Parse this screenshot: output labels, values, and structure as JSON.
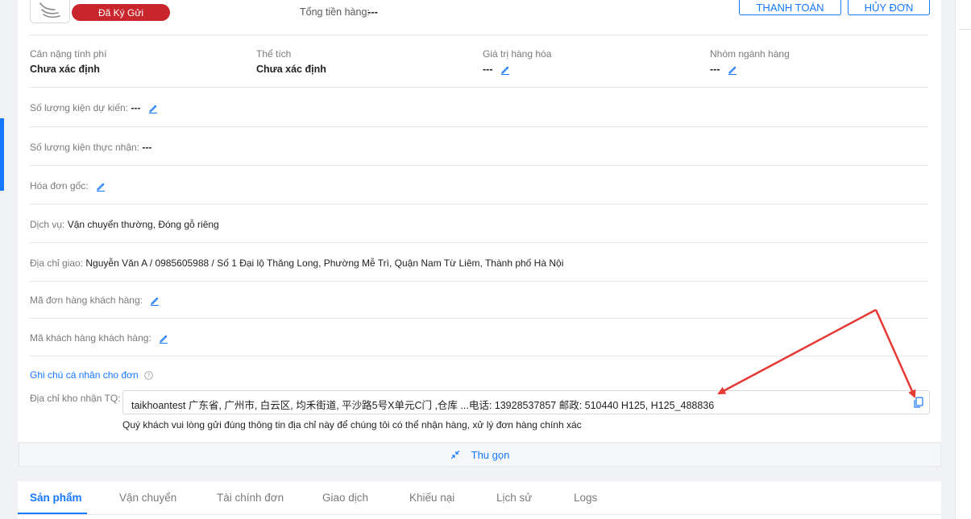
{
  "header": {
    "status_badge": "Đã Ký Gửi",
    "total_label": "Tổng tiền hàng:",
    "total_value": "---",
    "pay_button": "THANH TOÁN",
    "cancel_button": "HỦY ĐƠN"
  },
  "info": {
    "weight": {
      "label": "Cân nặng tính phí",
      "value": "Chưa xác định"
    },
    "volume": {
      "label": "Thể tích",
      "value": "Chưa xác định"
    },
    "goods_value": {
      "label": "Giá trị hàng hóa",
      "value": "---"
    },
    "category": {
      "label": "Nhóm ngành hàng",
      "value": "---"
    }
  },
  "rows": {
    "expected_packages": {
      "label": "Số lượng kiện dự kiến:",
      "value": "---"
    },
    "received_packages": {
      "label": "Số lượng kiện thực nhận:",
      "value": "---"
    },
    "original_invoice": {
      "label": "Hóa đơn gốc:"
    },
    "service": {
      "label": "Dịch vụ:",
      "value": "Vận chuyển thường,  Đóng gỗ riêng"
    },
    "delivery_address": {
      "label": "Địa chỉ giao:",
      "value": "Nguyễn Văn A / 0985605988 / Số 1 Đại lộ Thăng Long, Phường Mễ Trì, Quận Nam Từ Liêm, Thành phố Hà Nội"
    },
    "customer_order_code": {
      "label": "Mã đơn hàng khách hàng:"
    },
    "customer_code": {
      "label": "Mã khách hàng khách hàng:"
    }
  },
  "note": {
    "title": "Ghi chú cá nhân cho đơn",
    "warehouse_label": "Địa chỉ kho nhận TQ:",
    "warehouse_address": "taikhoantest 广东省, 广州市, 白云区, 均禾街道, 平沙路5号X单元C门 ,仓库 ...电话: 13928537857 邮政: 510440 H125, H125_488836",
    "hint": "Quý khách vui lòng gửi đúng thông tin địa chỉ này để chúng tôi có thể nhận hàng, xử lý đơn hàng chính xác"
  },
  "collapse": {
    "label": "Thu gọn"
  },
  "tabs": [
    {
      "label": "Sản phẩm"
    },
    {
      "label": "Vận chuyển"
    },
    {
      "label": "Tài chính đơn"
    },
    {
      "label": "Giao dịch"
    },
    {
      "label": "Khiếu nại"
    },
    {
      "label": "Lịch sử"
    },
    {
      "label": "Logs"
    }
  ],
  "colors": {
    "primary": "#1677ff",
    "badge": "#c8262c",
    "annotation_arrow": "#e53935"
  }
}
